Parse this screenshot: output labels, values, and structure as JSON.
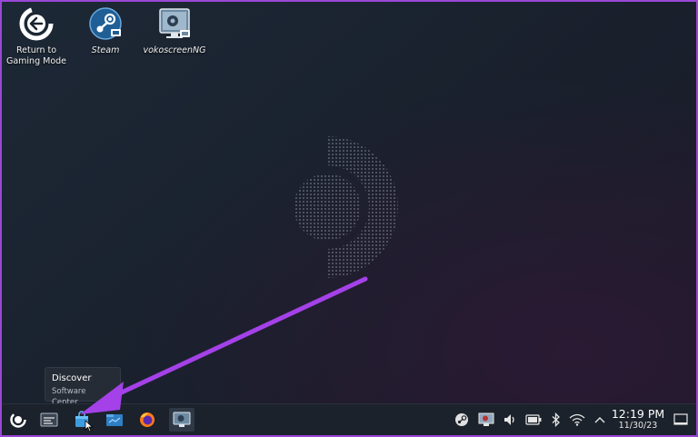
{
  "desktop": {
    "icons": [
      {
        "label": "Return to Gaming Mode",
        "icon": "return-arrow-icon"
      },
      {
        "label": "Steam",
        "icon": "steam-icon"
      },
      {
        "label": "vokoscreenNG",
        "icon": "vokoscreen-icon"
      }
    ],
    "wallpaper_logo": "steam-deck-logo"
  },
  "tooltip": {
    "title": "Discover",
    "subtitle": "Software Center"
  },
  "taskbar": {
    "launcher_icon": "steamos-launcher-icon",
    "apps": [
      "task-manager-icon",
      "discover-icon",
      "dolphin-icon",
      "firefox-icon",
      "vokoscreen-icon"
    ],
    "tray": [
      "steam-icon",
      "vokoscreen-tray-icon",
      "volume-icon",
      "battery-icon",
      "bluetooth-icon",
      "wifi-icon",
      "chevron-up-icon",
      "show-desktop-icon"
    ],
    "clock": {
      "time": "12:19 PM",
      "date": "11/30/23"
    }
  },
  "annotation": {
    "arrow_color": "#a441e8"
  }
}
